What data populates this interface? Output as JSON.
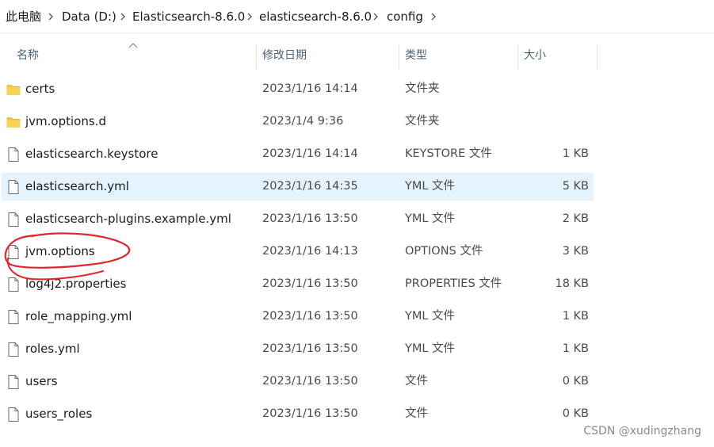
{
  "breadcrumb": {
    "items": [
      "此电脑",
      "Data (D:)",
      "Elasticsearch-8.6.0",
      "elasticsearch-8.6.0",
      "config"
    ]
  },
  "columns": {
    "name": "名称",
    "date": "修改日期",
    "type": "类型",
    "size": "大小"
  },
  "files": [
    {
      "name": "certs",
      "date": "2023/1/16 14:14",
      "type": "文件夹",
      "size": "",
      "kind": "folder-icon"
    },
    {
      "name": "jvm.options.d",
      "date": "2023/1/4 9:36",
      "type": "文件夹",
      "size": "",
      "kind": "folder-icon"
    },
    {
      "name": "elasticsearch.keystore",
      "date": "2023/1/16 14:14",
      "type": "KEYSTORE 文件",
      "size": "1 KB",
      "kind": "file-icon"
    },
    {
      "name": "elasticsearch.yml",
      "date": "2023/1/16 14:35",
      "type": "YML 文件",
      "size": "5 KB",
      "kind": "file-icon",
      "selected": true
    },
    {
      "name": "elasticsearch-plugins.example.yml",
      "date": "2023/1/16 13:50",
      "type": "YML 文件",
      "size": "2 KB",
      "kind": "file-icon"
    },
    {
      "name": "jvm.options",
      "date": "2023/1/16 14:13",
      "type": "OPTIONS 文件",
      "size": "3 KB",
      "kind": "file-icon"
    },
    {
      "name": "log4j2.properties",
      "date": "2023/1/16 13:50",
      "type": "PROPERTIES 文件",
      "size": "18 KB",
      "kind": "file-icon"
    },
    {
      "name": "role_mapping.yml",
      "date": "2023/1/16 13:50",
      "type": "YML 文件",
      "size": "1 KB",
      "kind": "file-icon"
    },
    {
      "name": "roles.yml",
      "date": "2023/1/16 13:50",
      "type": "YML 文件",
      "size": "1 KB",
      "kind": "file-icon"
    },
    {
      "name": "users",
      "date": "2023/1/16 13:50",
      "type": "文件",
      "size": "0 KB",
      "kind": "file-icon"
    },
    {
      "name": "users_roles",
      "date": "2023/1/16 13:50",
      "type": "文件",
      "size": "0 KB",
      "kind": "file-icon"
    }
  ],
  "watermark": "CSDN @xudingzhang",
  "colors": {
    "selection": "#e5f3ff",
    "folder": "#f8c43a",
    "annotation": "#e0262a",
    "header_text": "#4c607a"
  }
}
